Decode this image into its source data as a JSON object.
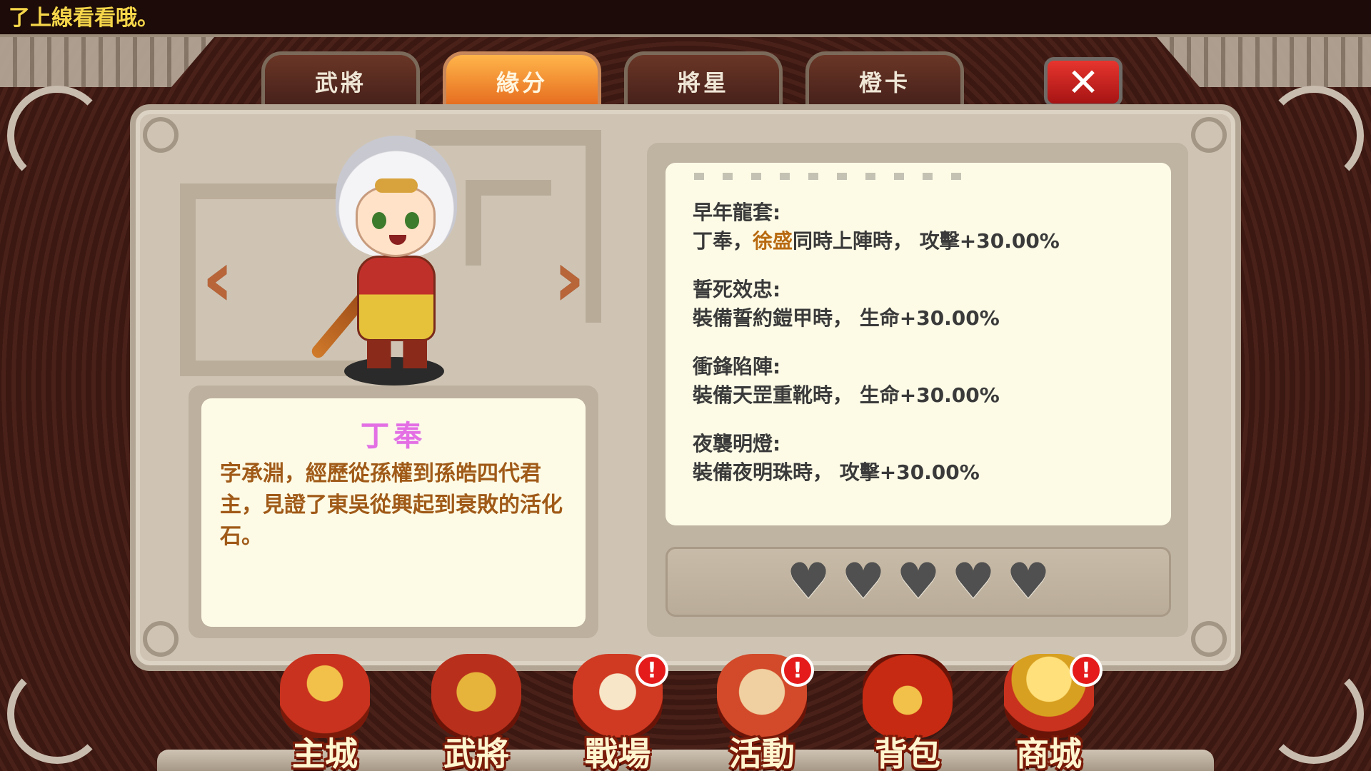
{
  "marquee": "了上線看看哦。",
  "tabs": [
    {
      "label": "武將",
      "active": false
    },
    {
      "label": "緣分",
      "active": true
    },
    {
      "label": "將星",
      "active": false
    },
    {
      "label": "橙卡",
      "active": false
    }
  ],
  "close_glyph": "✕",
  "arrows": {
    "prev": "‹",
    "next": "›"
  },
  "hero": {
    "name": "丁奉",
    "description": "字承淵，經歷從孫權到孫皓四代君主，見證了東吳從興起到衰敗的活化石。"
  },
  "fates": [
    {
      "title": "早年龍套:",
      "desc_pre": "丁奉，",
      "desc_highlight": "徐盛",
      "desc_post": "同時上陣時，  攻擊+30.00%"
    },
    {
      "title": "誓死效忠:",
      "desc_pre": "裝備誓約鎧甲時，  生命+30.00%",
      "desc_highlight": "",
      "desc_post": ""
    },
    {
      "title": "衝鋒陷陣:",
      "desc_pre": "裝備天罡重靴時，  生命+30.00%",
      "desc_highlight": "",
      "desc_post": ""
    },
    {
      "title": "夜襲明燈:",
      "desc_pre": "裝備夜明珠時，  攻擊+30.00%",
      "desc_highlight": "",
      "desc_post": ""
    }
  ],
  "hearts": {
    "glyph": "♥",
    "filled": 0,
    "total": 5
  },
  "nav": [
    {
      "label": "主城",
      "icon": "palace-icon",
      "color": "#c8321e",
      "badge": ""
    },
    {
      "label": "武將",
      "icon": "helmet-icon",
      "color": "#b8301c",
      "badge": ""
    },
    {
      "label": "戰場",
      "icon": "war-banner-icon",
      "color": "#d03a22",
      "badge": "!"
    },
    {
      "label": "活動",
      "icon": "drum-icon",
      "color": "#d24a2a",
      "badge": "!"
    },
    {
      "label": "背包",
      "icon": "bag-icon",
      "color": "#c62a12",
      "badge": ""
    },
    {
      "label": "商城",
      "icon": "gold-ingot-icon",
      "color": "#d8a020",
      "badge": "!"
    }
  ]
}
